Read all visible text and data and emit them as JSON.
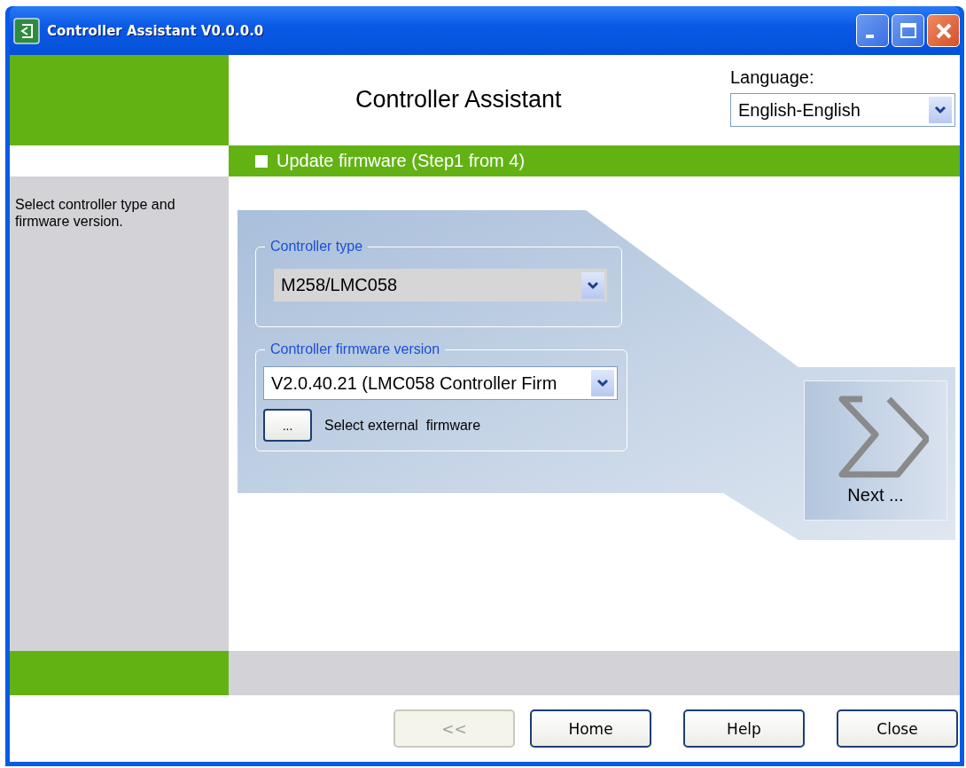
{
  "window": {
    "title": "Controller Assistant V0.0.0.0"
  },
  "header": {
    "title": "Controller Assistant",
    "language": {
      "label": "Language:",
      "value": "English-English"
    }
  },
  "step": {
    "text": "Update firmware (Step1 from 4)"
  },
  "sidebar": {
    "text": "Select controller type and firmware version."
  },
  "controller_type": {
    "legend": "Controller type",
    "value": "M258/LMC058"
  },
  "firmware": {
    "legend": "Controller firmware version",
    "value": "V2.0.40.21 (LMC058 Controller Firm",
    "browse_button": "...",
    "browse_label": "Select external  firmware"
  },
  "next_button": {
    "label": "Next ..."
  },
  "footer_buttons": [
    {
      "label": "<<",
      "disabled": true
    },
    {
      "label": "Home",
      "disabled": false
    },
    {
      "label": "Help",
      "disabled": false
    },
    {
      "label": "Close",
      "disabled": false
    }
  ]
}
